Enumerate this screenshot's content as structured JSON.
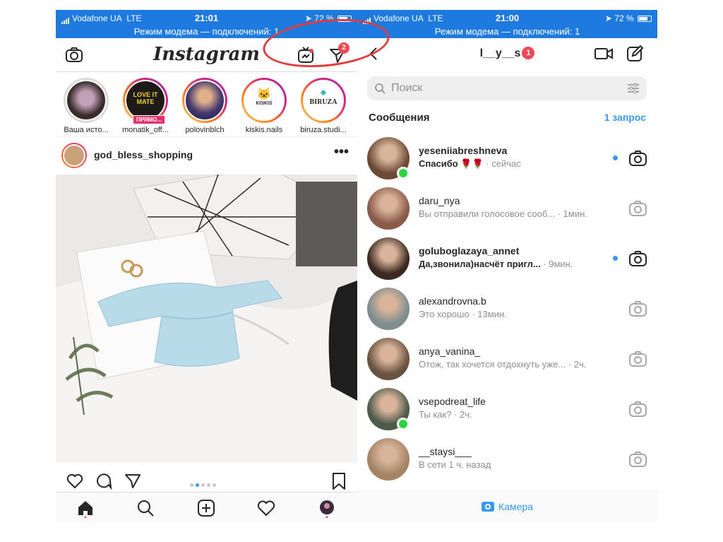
{
  "left": {
    "status": {
      "carrier": "Vodafone UA",
      "network": "LTE",
      "time": "21:01",
      "battery": "72 %",
      "hotspot": "Режим модема — подключений: 1"
    },
    "header": {
      "logo": "Instagram",
      "badge": "2"
    },
    "stories": [
      {
        "name": "Ваша исто...",
        "seen": true,
        "avatar_color": "#3a2c2a"
      },
      {
        "name": "monatik_off...",
        "live": "ПРЯМО...",
        "avatar_color": "#1d1a18"
      },
      {
        "name": "polovinblch",
        "avatar_color": "#4a3b70"
      },
      {
        "name": "kiskis.nails",
        "logo_text": "KISKIS",
        "avatar_color": "#ffffff"
      },
      {
        "name": "biruza.studi...",
        "logo_text": "BIRUZA",
        "avatar_color": "#ffffff"
      }
    ],
    "post": {
      "user": "god_bless_shopping",
      "more": "•••",
      "dots": [
        false,
        true,
        false,
        false,
        false
      ]
    },
    "tabs": [
      "home-icon",
      "search-icon",
      "add-icon",
      "heart-icon",
      "profile-icon"
    ]
  },
  "right": {
    "status": {
      "carrier": "Vodafone UA",
      "network": "LTE",
      "time": "21:00",
      "battery": "72 %",
      "hotspot": "Режим модема — подключений: 1"
    },
    "header": {
      "title": "l__y__s",
      "count": "1"
    },
    "search": {
      "placeholder": "Поиск"
    },
    "section": {
      "title": "Сообщения",
      "requests": "1 запрос"
    },
    "threads": [
      {
        "user": "yeseniiabreshneva",
        "message": "Спасибо 🌹🌹",
        "time": " · сейчас",
        "unread": true,
        "online": true,
        "color": "#6b4a35"
      },
      {
        "user": "daru_nya",
        "message": "Вы отправили голосовое сооб...",
        "time": " · 1мин.",
        "unread": false,
        "online": false,
        "color": "#8a5a4a"
      },
      {
        "user": "goluboglazaya_annet",
        "message": "Да,звонила)насчёт пригл...",
        "time": " · 9мин.",
        "unread": true,
        "online": false,
        "color": "#3c2a22"
      },
      {
        "user": "alexandrovna.b",
        "message": "Это хорошо",
        "time": " · 13мин.",
        "unread": false,
        "online": false,
        "color": "#7f8d8f"
      },
      {
        "user": "anya_vanina_",
        "message": "Отож, так хочется отдохнуть уже...",
        "time": " · 2ч.",
        "unread": false,
        "online": false,
        "color": "#6a5240"
      },
      {
        "user": "vsepodreat_life",
        "message": "Ты как?",
        "time": " · 2ч.",
        "unread": false,
        "online": true,
        "color": "#4c5a4a"
      },
      {
        "user": "__staysi___",
        "message": "В сети 1 ч. назад",
        "time": "",
        "unread": false,
        "online": false,
        "color": "#a58466"
      }
    ],
    "footer": {
      "camera": "Камера"
    }
  },
  "colors": {
    "status_bar": "#1f7ae0",
    "accent": "#3897f0",
    "badge": "#ed4956",
    "online": "#2bd43c",
    "annotation": "#e23b3b"
  }
}
